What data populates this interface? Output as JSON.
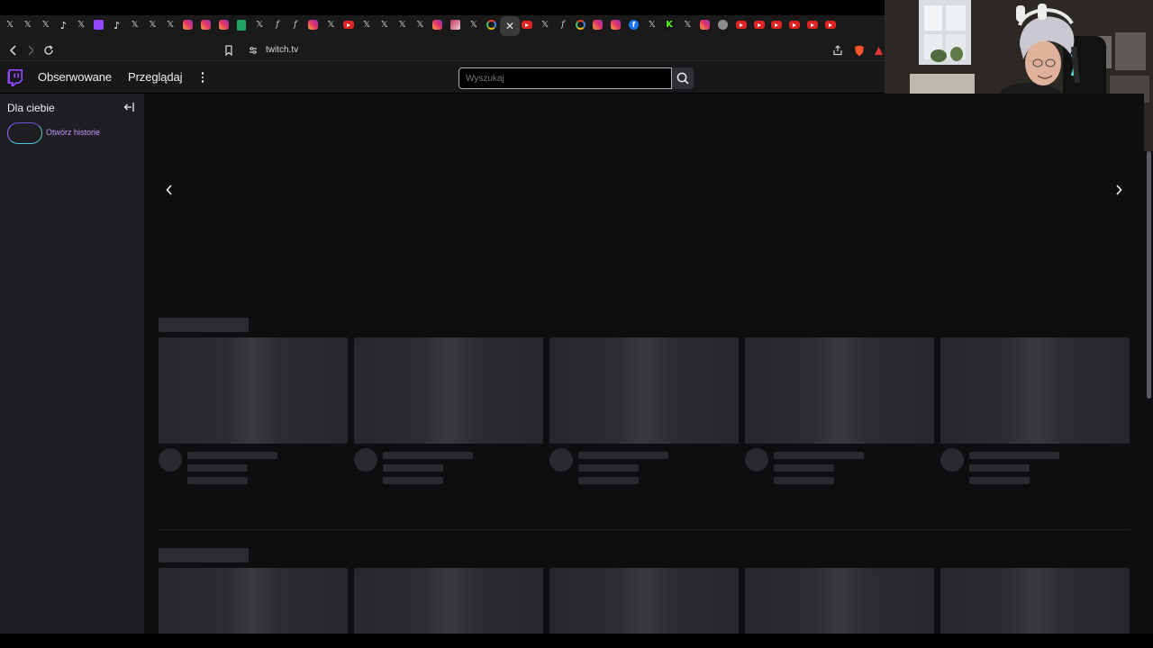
{
  "browser": {
    "tabs": [
      {
        "type": "x",
        "icon": "x-icon"
      },
      {
        "type": "x",
        "icon": "x-icon"
      },
      {
        "type": "x",
        "icon": "x-icon"
      },
      {
        "type": "tiktok",
        "icon": "tiktok-icon"
      },
      {
        "type": "x",
        "icon": "x-icon"
      },
      {
        "type": "twitchtab",
        "icon": "twitch-icon"
      },
      {
        "type": "tiktok",
        "icon": "tiktok-icon"
      },
      {
        "type": "x",
        "icon": "x-icon"
      },
      {
        "type": "x",
        "icon": "x-icon"
      },
      {
        "type": "x",
        "icon": "x-icon"
      },
      {
        "type": "insta",
        "icon": "instagram-icon"
      },
      {
        "type": "insta",
        "icon": "instagram-icon"
      },
      {
        "type": "insta",
        "icon": "instagram-icon"
      },
      {
        "type": "sheets",
        "icon": "sheets-icon"
      },
      {
        "type": "x",
        "icon": "x-icon"
      },
      {
        "type": "font",
        "icon": "font-icon"
      },
      {
        "type": "font",
        "icon": "font-icon"
      },
      {
        "type": "insta",
        "icon": "instagram-icon"
      },
      {
        "type": "x",
        "icon": "x-icon"
      },
      {
        "type": "yt",
        "icon": "youtube-icon"
      },
      {
        "type": "x",
        "icon": "x-icon"
      },
      {
        "type": "x",
        "icon": "x-icon"
      },
      {
        "type": "x",
        "icon": "x-icon"
      },
      {
        "type": "x",
        "icon": "x-icon"
      },
      {
        "type": "insta",
        "icon": "instagram-icon"
      },
      {
        "type": "insta-thumb",
        "icon": "image-icon"
      },
      {
        "type": "x",
        "icon": "x-icon"
      },
      {
        "type": "google",
        "icon": "google-icon"
      },
      {
        "type": "speaker",
        "icon": "speaker-icon"
      },
      {
        "type": "yt",
        "icon": "youtube-icon"
      },
      {
        "type": "x",
        "icon": "x-icon"
      },
      {
        "type": "font",
        "icon": "font-icon"
      },
      {
        "type": "google",
        "icon": "google-icon"
      },
      {
        "type": "insta",
        "icon": "instagram-icon"
      },
      {
        "type": "insta",
        "icon": "instagram-icon"
      },
      {
        "type": "fb",
        "icon": "facebook-icon"
      },
      {
        "type": "x",
        "icon": "x-icon"
      },
      {
        "type": "kick",
        "icon": "kick-icon"
      },
      {
        "type": "x",
        "icon": "x-icon"
      },
      {
        "type": "insta",
        "icon": "instagram-icon"
      },
      {
        "type": "wolf",
        "icon": "wolf-icon"
      },
      {
        "type": "yt",
        "icon": "youtube-icon"
      },
      {
        "type": "yt",
        "icon": "youtube-icon"
      },
      {
        "type": "yt",
        "icon": "youtube-icon"
      },
      {
        "type": "yt",
        "icon": "youtube-icon"
      },
      {
        "type": "yt",
        "icon": "youtube-icon"
      },
      {
        "type": "yt",
        "icon": "youtube-icon"
      }
    ],
    "active_tab_icon": "close-icon",
    "url": "twitch.tv"
  },
  "nav": {
    "following_label": "Obserwowane",
    "browse_label": "Przeglądaj",
    "search_placeholder": "Wyszukaj"
  },
  "sidebar": {
    "title": "Dla ciebie",
    "story_label": "Otwórz historie"
  },
  "colors": {
    "accent": "#9146ff",
    "story_text": "#bf94ff",
    "background": "#0e0e10",
    "sidebar": "#1f1f23"
  }
}
